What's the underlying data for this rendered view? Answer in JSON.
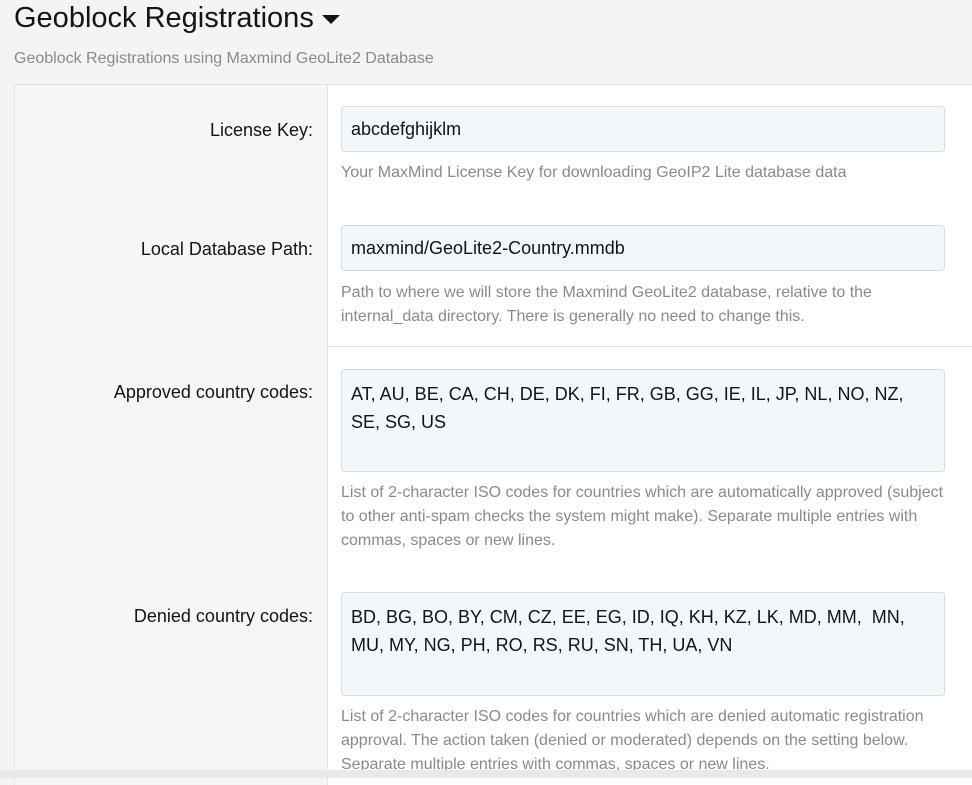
{
  "header": {
    "title": "Geoblock Registrations",
    "subtitle": "Geoblock Registrations using Maxmind GeoLite2 Database"
  },
  "fields": {
    "license_key": {
      "label": "License Key:",
      "value": "abcdefghijklm",
      "hint": "Your MaxMind License Key for downloading GeoIP2 Lite database data"
    },
    "db_path": {
      "label": "Local Database Path:",
      "value": "maxmind/GeoLite2-Country.mmdb",
      "hint": "Path to where we will store the Maxmind GeoLite2 database, relative to the internal_data directory. There is generally no need to change this."
    },
    "approved": {
      "label": "Approved country codes:",
      "value": "AT, AU, BE, CA, CH, DE, DK, FI, FR, GB, GG, IE, IL, JP, NL, NO, NZ, SE, SG, US",
      "hint": "List of 2-character ISO codes for countries which are automatically approved (subject to other anti-spam checks the system might make). Separate multiple entries with commas, spaces or new lines."
    },
    "denied": {
      "label": "Denied country codes:",
      "value": "BD, BG, BO, BY, CM, CZ, EE, EG, ID, IQ, KH, KZ, LK, MD, MM,  MN, MU, MY, NG, PH, RO, RS, RU, SN, TH, UA, VN",
      "hint": "List of 2-character ISO codes for countries which are denied automatic registration approval. The action taken (denied or moderated) depends on the setting below. Separate multiple entries with commas, spaces or new lines."
    }
  },
  "colors": {
    "input_bg": "#f1f7fb",
    "hint_text": "#8a8a8a",
    "label_col_bg": "#f6f6f6"
  },
  "icons": {
    "title_dropdown": "caret-down-icon"
  }
}
